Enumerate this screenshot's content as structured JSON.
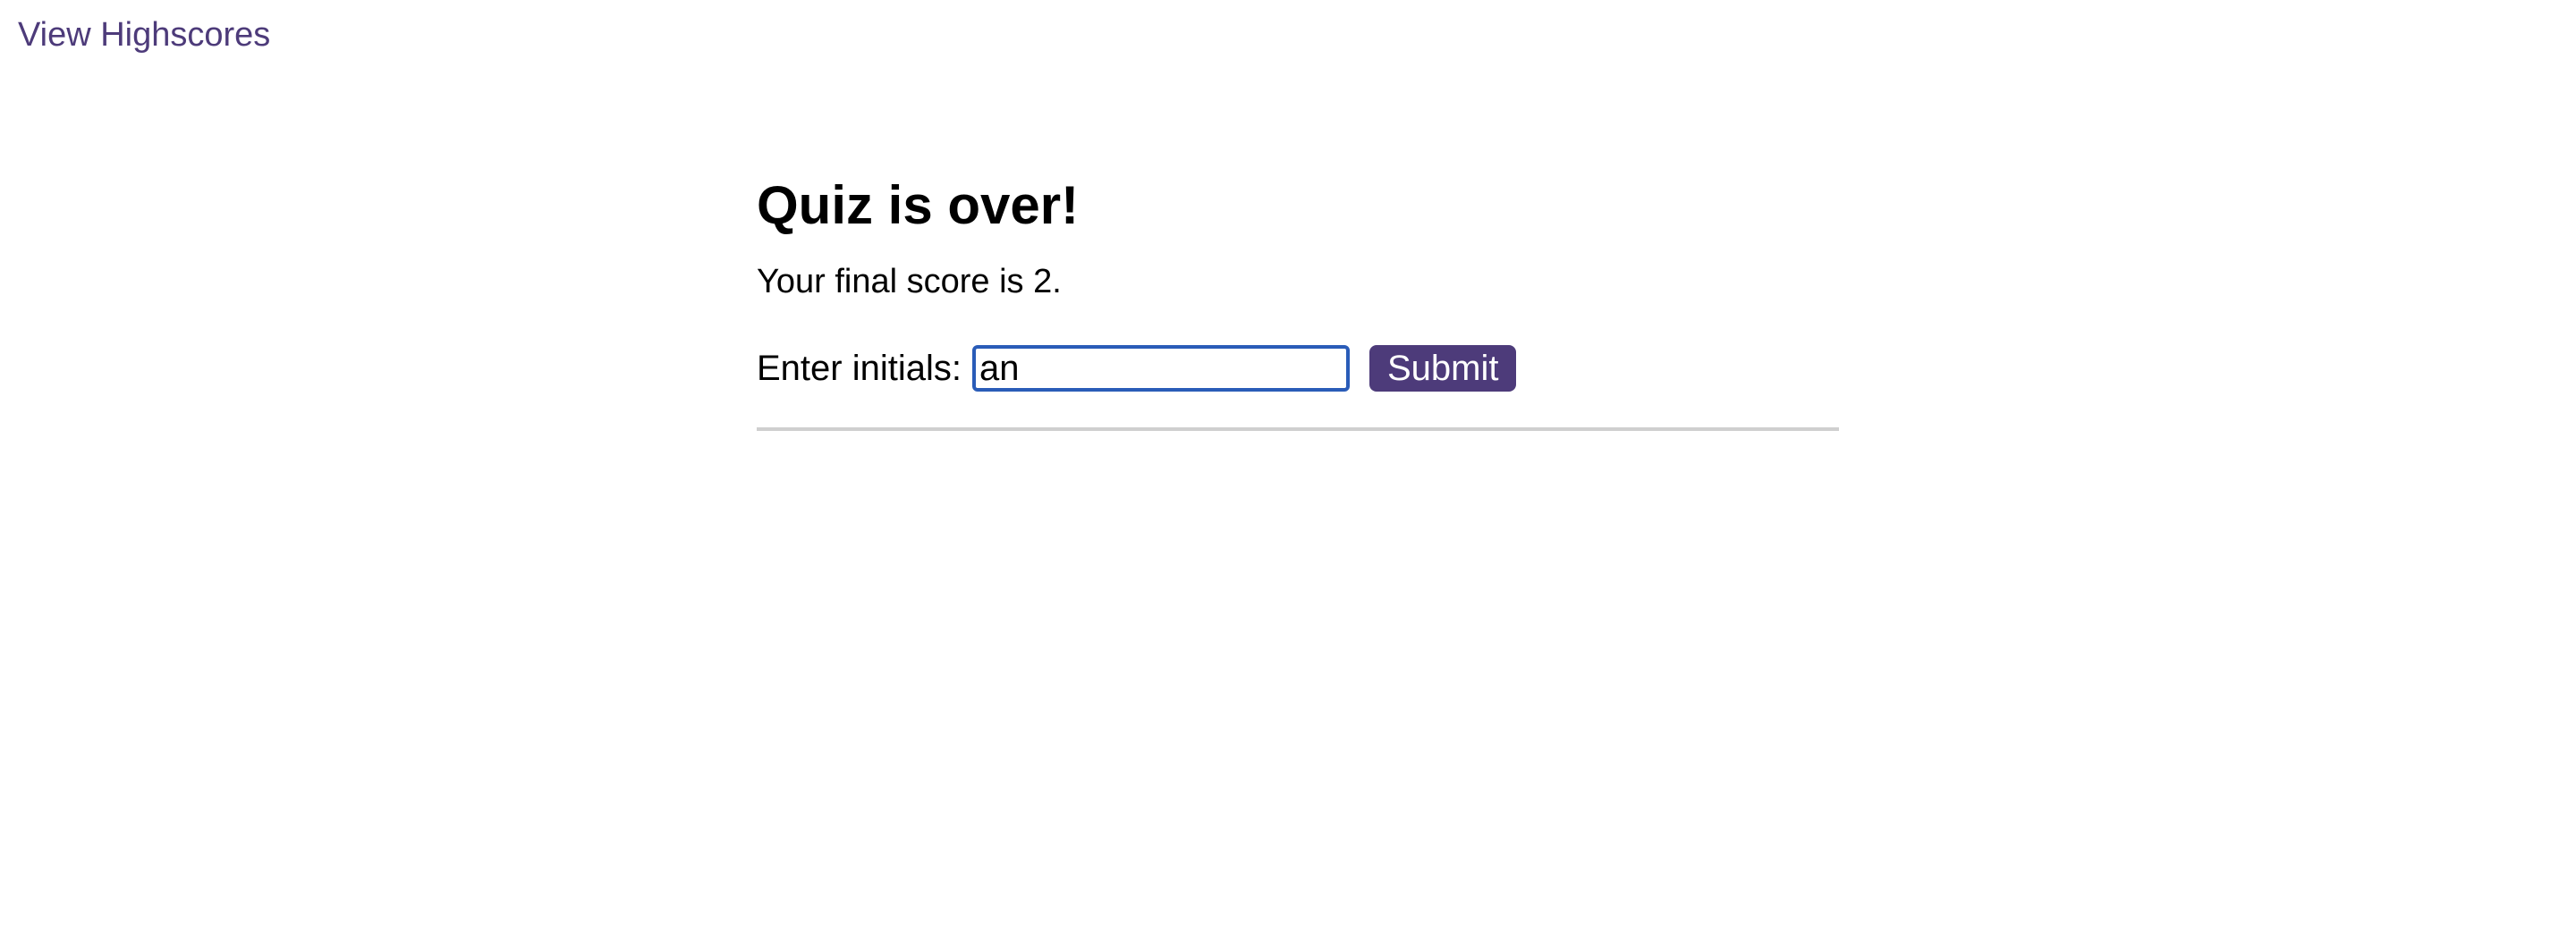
{
  "nav": {
    "highscores_link": "View Highscores"
  },
  "quiz": {
    "title": "Quiz is over!",
    "final_score_text": "Your final score is 2.",
    "initials_label": "Enter initials:",
    "initials_value": "an",
    "submit_label": "Submit"
  },
  "colors": {
    "accent": "#4d3b7a",
    "input_focus_border": "#2a5cb8",
    "divider": "#cfcfcf"
  }
}
